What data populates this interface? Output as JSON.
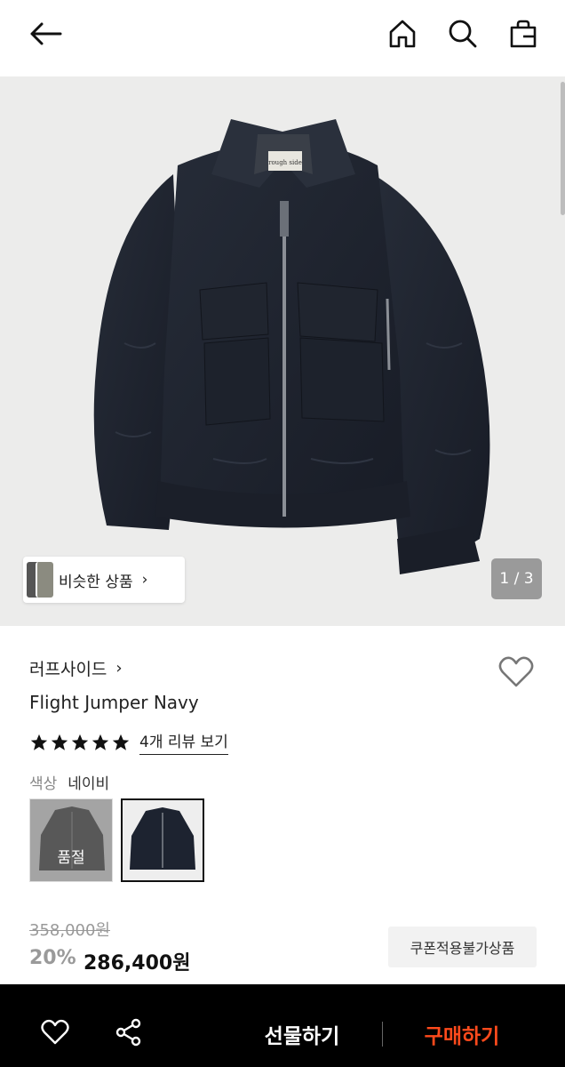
{
  "header": {
    "back_icon": "arrow-left-icon",
    "home_icon": "home-icon",
    "search_icon": "search-icon",
    "bag_icon": "shopping-bag-icon"
  },
  "hero": {
    "similar_label": "비슷한 상품",
    "similar_chevron": "›",
    "counter": "1 / 3",
    "collar_tag": "rough side"
  },
  "product": {
    "brand": "러프사이드",
    "brand_chevron": "›",
    "name": "Flight Jumper Navy",
    "rating": 5,
    "review_link": "4개 리뷰 보기",
    "color_label": "색상",
    "color_value": "네이비",
    "swatches": [
      {
        "color": "#3f3f3f",
        "soldout_label": "품절"
      },
      {
        "color": "#1d2330"
      }
    ],
    "original_price": "358,000원",
    "discount": "20%",
    "sale_price": "286,400원",
    "coupon_label": "쿠폰적용불가상품"
  },
  "bottom_bar": {
    "like_icon": "heart-icon",
    "share_icon": "share-icon",
    "gift_label": "선물하기",
    "buy_label": "구매하기",
    "buy_color": "#ff4a1c"
  },
  "colors": {
    "accent": "#ff4a1c",
    "jacket": "#1f2430"
  }
}
